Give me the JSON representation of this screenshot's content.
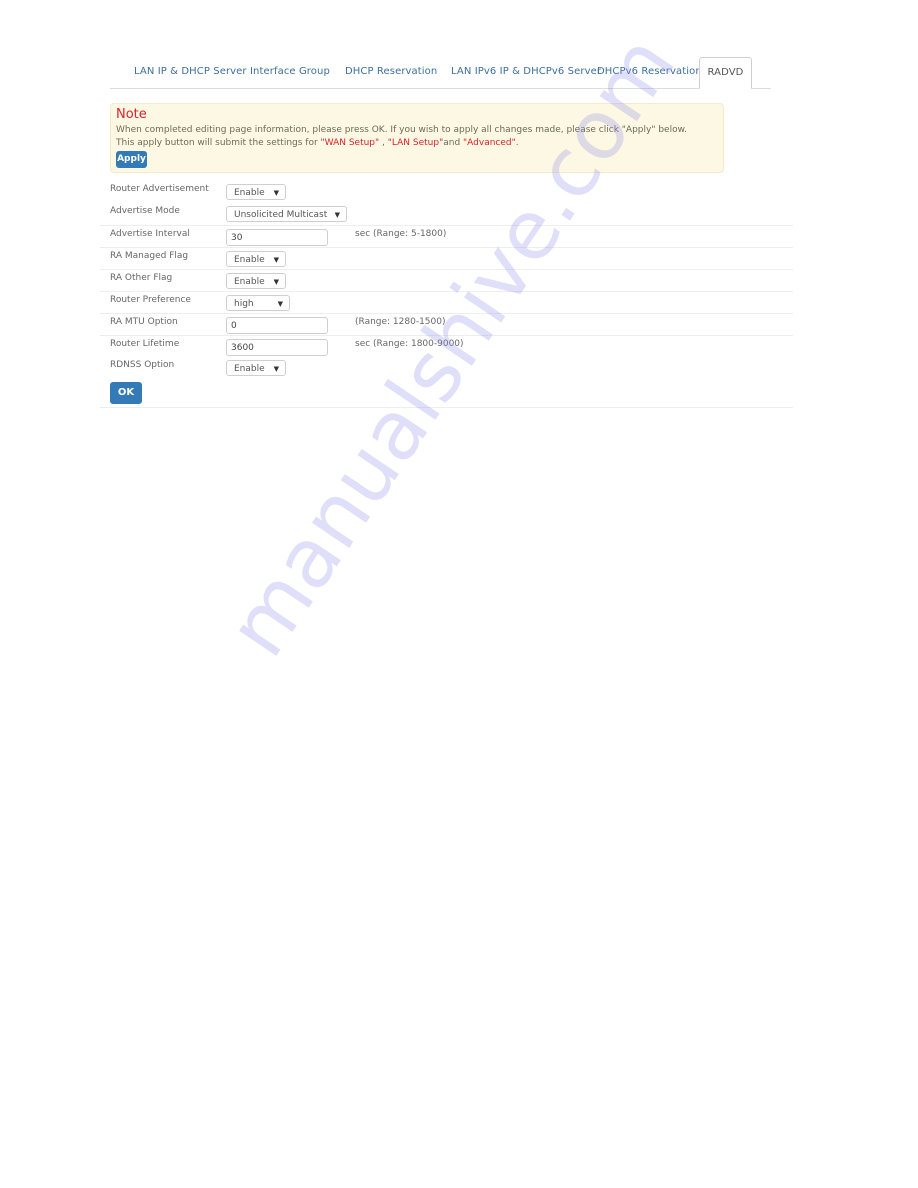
{
  "tabs": [
    {
      "label": "LAN IP & DHCP Server",
      "active": false
    },
    {
      "label": "Interface Group",
      "active": false
    },
    {
      "label": "DHCP Reservation",
      "active": false
    },
    {
      "label": "LAN IPv6 IP & DHCPv6 Server",
      "active": false
    },
    {
      "label": "DHCPv6 Reservation",
      "active": false
    },
    {
      "label": "RADVD",
      "active": true
    }
  ],
  "note": {
    "title": "Note",
    "line1": "When completed editing page information, please press OK. If you wish to apply all changes made, please click \"Apply\" below.",
    "line2_prefix": "This apply button will submit the settings for ",
    "wan_setup": "\"WAN Setup\"",
    "sep": " , ",
    "lan_setup": "\"LAN Setup\"",
    "and": "and ",
    "advanced": "\"Advanced\"",
    "period": ".",
    "apply_label": "Apply",
    "highlight_color": "#d9232d"
  },
  "form": {
    "router_advertisement": {
      "label": "Router Advertisement",
      "value": "Enable"
    },
    "advertise_mode": {
      "label": "Advertise Mode",
      "value": "Unsolicited Multicast"
    },
    "advertise_interval": {
      "label": "Advertise Interval",
      "value": "30",
      "hint": "sec (Range: 5-1800)"
    },
    "ra_managed_flag": {
      "label": "RA Managed Flag",
      "value": "Enable"
    },
    "ra_other_flag": {
      "label": "RA Other Flag",
      "value": "Enable"
    },
    "router_preference": {
      "label": "Router Preference",
      "value": "high"
    },
    "ra_mtu_option": {
      "label": "RA MTU Option",
      "value": "0",
      "hint": "(Range: 1280-1500)"
    },
    "router_lifetime": {
      "label": "Router Lifetime",
      "value": "3600",
      "hint": "sec (Range: 1800-9000)"
    },
    "rdnss_option": {
      "label": "RDNSS Option",
      "value": "Enable"
    }
  },
  "ok_label": "OK",
  "dropdown_arrow": "▼",
  "primary_color": "#337ab7",
  "watermark": "manualshive.com"
}
